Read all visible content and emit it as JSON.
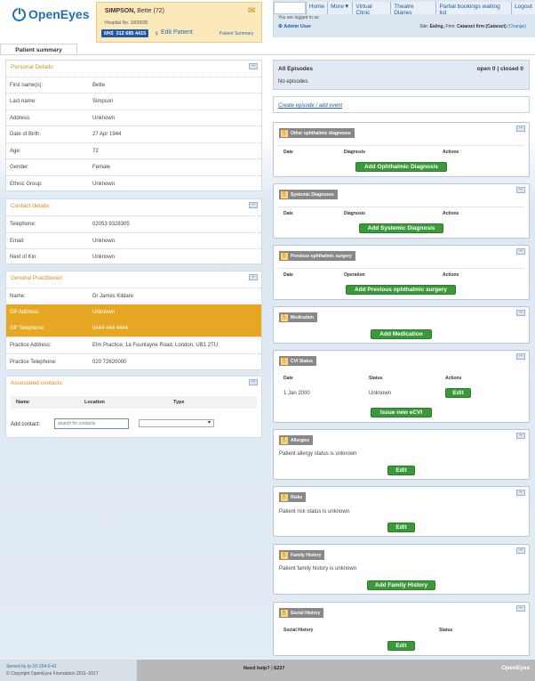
{
  "app": {
    "logo": "OpenEyes"
  },
  "patient": {
    "surname": "SIMPSON,",
    "forename": "Bette",
    "age": "(72)",
    "hospital_no": "Hospital No. 1009028",
    "nhs_label": "NHS",
    "nhs_number": "312 685 4415",
    "edit_patient": "Edit Patient",
    "patient_summary": "Patient Summary"
  },
  "nav": {
    "items": [
      "Home",
      "More▼",
      "Virtual Clinic",
      "Theatre Diaries",
      "Partial bookings waiting list",
      "Logout"
    ],
    "logged_in": "You are logged in as:",
    "user": "Admin User",
    "site_label": "Site:",
    "site": "Ealing,",
    "firm_label": "Firm:",
    "firm": "Cataract firm (Cataract)",
    "change": "(Change)"
  },
  "tab": {
    "label": "Patient summary"
  },
  "personal": {
    "title": "Personal Details:",
    "rows": [
      {
        "k": "First name(s):",
        "v": "Bette"
      },
      {
        "k": "Last name:",
        "v": "Simpson"
      },
      {
        "k": "Address:",
        "v": "Unknown"
      },
      {
        "k": "Date of Birth:",
        "v": "27 Apr 1944"
      },
      {
        "k": "Age:",
        "v": "72"
      },
      {
        "k": "Gender:",
        "v": "Female"
      },
      {
        "k": "Ethnic Group:",
        "v": "Unknown"
      }
    ]
  },
  "contact": {
    "title": "Contact details:",
    "rows": [
      {
        "k": "Telephone:",
        "v": "02053 9328305"
      },
      {
        "k": "Email:",
        "v": "Unknown"
      },
      {
        "k": "Next of Kin:",
        "v": "Unknown"
      }
    ]
  },
  "gp": {
    "title": "General Practitioner:",
    "rows": [
      {
        "k": "Name:",
        "v": "Dr James Kildare"
      },
      {
        "k": "GP Address:",
        "v": "Unknown"
      },
      {
        "k": "GP Telephone:",
        "v": "0444 444 4444"
      },
      {
        "k": "Practice Address:",
        "v": "Elm Practice, 1a Fountayne Road, London, UB1 2TU"
      },
      {
        "k": "Practice Telephone:",
        "v": "020 72620000"
      }
    ]
  },
  "assoc": {
    "title": "Associated contacts:",
    "cols": [
      "Name",
      "Location",
      "Type"
    ],
    "add_label": "Add contact:",
    "search_placeholder": "search for contacts"
  },
  "episodes": {
    "title": "All Episodes",
    "open": "open 0",
    "sep": "|",
    "closed": "closed 0",
    "empty": "No episodes",
    "create_link": "Create episode / add event"
  },
  "widgets": {
    "ophthalmic_diag": {
      "title": "Other ophthalmic diagnoses",
      "cols": [
        "Date",
        "Diagnosis",
        "Actions"
      ],
      "button": "Add Ophthalmic Diagnosis"
    },
    "systemic_diag": {
      "title": "Systemic Diagnoses",
      "cols": [
        "Date",
        "Diagnosis",
        "Actions"
      ],
      "button": "Add Systemic Diagnosis"
    },
    "prev_surgery": {
      "title": "Previous ophthalmic surgery",
      "cols": [
        "Date",
        "Operation",
        "Actions"
      ],
      "button": "Add Previous ophthalmic surgery"
    },
    "medication": {
      "title": "Medication",
      "button": "Add Medication"
    },
    "cvi": {
      "title": "CVI Status",
      "cols": [
        "Date",
        "Status",
        "Actions"
      ],
      "row": {
        "date": "1 Jan 2000",
        "status": "Unknown",
        "action": "Edit"
      },
      "button": "Issue new eCVI"
    },
    "allergies": {
      "title": "Allergies",
      "text": "Patient allergy status is unknown",
      "button": "Edit"
    },
    "risks": {
      "title": "Risks",
      "text": "Patient risk status is unknown",
      "button": "Edit"
    },
    "family": {
      "title": "Family History",
      "text": "Patient family history is unknown",
      "button": "Add Family History"
    },
    "social": {
      "title": "Social History",
      "cols": [
        "Social History",
        "Status"
      ],
      "button": "Edit"
    }
  },
  "footer": {
    "served": "Served by ip-10-154-0-41",
    "copyright": "© Copyright OpenEyes Foundation 2011–2017",
    "help": "Need help?",
    "sep": "|",
    "phone": "6237",
    "logo": "OpenEyes"
  }
}
